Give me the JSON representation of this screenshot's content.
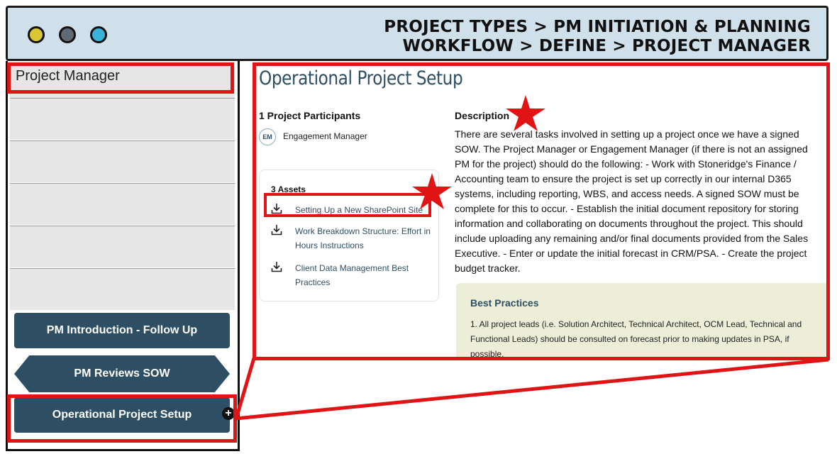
{
  "window": {
    "breadcrumb_line1": "PROJECT TYPES > PM INITIATION & PLANNING",
    "breadcrumb_line2": "WORKFLOW > DEFINE > PROJECT MANAGER"
  },
  "sidebar": {
    "header": "Project Manager",
    "steps": [
      {
        "label": "PM Introduction - Follow Up"
      },
      {
        "label": "PM Reviews SOW"
      },
      {
        "label": "Operational Project Setup"
      }
    ],
    "plus_glyph": "+"
  },
  "main": {
    "title": "Operational Project Setup",
    "participants_heading": "1 Project Participants",
    "participant": {
      "initials": "EM",
      "name": "Engagement Manager"
    },
    "assets_heading": "3 Assets",
    "assets": [
      {
        "label": "Setting Up a New SharePoint Site"
      },
      {
        "label": "Work Breakdown Structure: Effort in Hours Instructions"
      },
      {
        "label": "Client Data Management Best Practices"
      }
    ],
    "description_heading": "Description",
    "description": "There are several tasks involved in setting up a project once we have a signed SOW. The Project Manager or Engagement Manager (if there is not an assigned PM for the project) should do the following: - Work with Stoneridge's Finance / Accounting team to ensure the project is set up correctly in our internal D365 systems, including reporting, WBS, and access needs. A signed SOW must be complete for this to occur. - Establish the initial document repository for storing information and collaborating on documents throughout the project. This should include uploading any remaining and/or final documents provided from the Sales Executive. - Enter or update the initial forecast in CRM/PSA. - Create the project budget tracker.",
    "best_practices_heading": "Best Practices",
    "best_practices_text": "1. All project leads (i.e. Solution Architect, Technical Architect, OCM Lead, Technical and Functional Leads) should be consulted on forecast prior to making updates in PSA, if possible."
  },
  "colors": {
    "accent": "#2e4f63",
    "highlight": "#e01414",
    "titlebar": "#cfe0ea",
    "best_practices_bg": "#eceed8"
  }
}
